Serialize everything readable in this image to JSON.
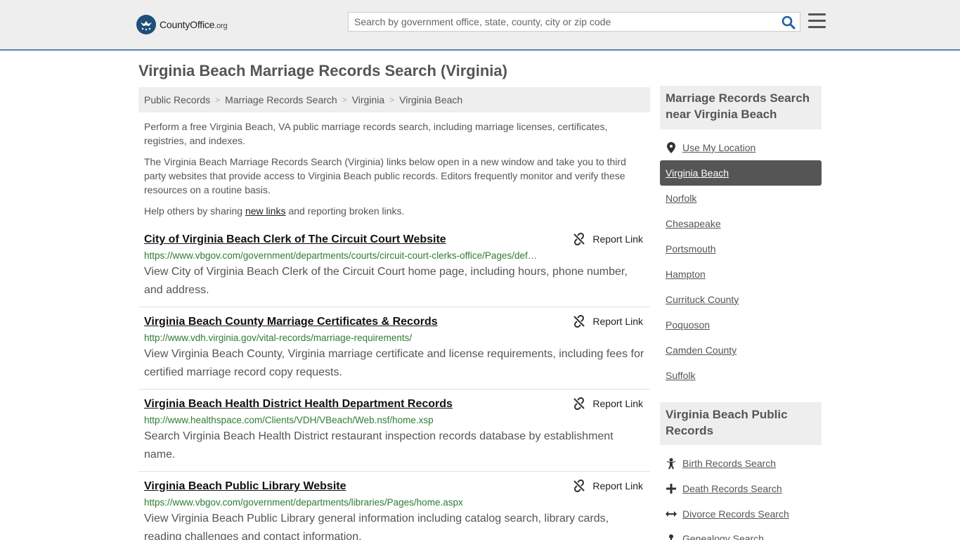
{
  "header": {
    "logo_name": "CountyOffice",
    "logo_tld": ".org",
    "search_placeholder": "Search by government office, state, county, city or zip code"
  },
  "page": {
    "title": "Virginia Beach Marriage Records Search (Virginia)"
  },
  "breadcrumb": [
    "Public Records",
    "Marriage Records Search",
    "Virginia",
    "Virginia Beach"
  ],
  "intro": {
    "p1": "Perform a free Virginia Beach, VA public marriage records search, including marriage licenses, certificates, registries, and indexes.",
    "p2": "The Virginia Beach Marriage Records Search (Virginia) links below open in a new window and take you to third party websites that provide access to Virginia Beach public records. Editors frequently monitor and verify these resources on a routine basis.",
    "p3_before": "Help others by sharing ",
    "p3_link": "new links",
    "p3_after": " and reporting broken links."
  },
  "report_label": "Report Link",
  "results": [
    {
      "title": "City of Virginia Beach Clerk of The Circuit Court Website",
      "url": "https://www.vbgov.com/government/departments/courts/circuit-court-clerks-office/Pages/def…",
      "desc": "View City of Virginia Beach Clerk of the Circuit Court home page, including hours, phone number, and address."
    },
    {
      "title": "Virginia Beach County Marriage Certificates & Records",
      "url": "http://www.vdh.virginia.gov/vital-records/marriage-requirements/",
      "desc": "View Virginia Beach County, Virginia marriage certificate and license requirements, including fees for certified marriage record copy requests."
    },
    {
      "title": "Virginia Beach Health District Health Department Records",
      "url": "http://www.healthspace.com/Clients/VDH/VBeach/Web.nsf/home.xsp",
      "desc": "Search Virginia Beach Health District restaurant inspection records database by establishment name."
    },
    {
      "title": "Virginia Beach Public Library Website",
      "url": "https://www.vbgov.com/government/departments/libraries/Pages/home.aspx",
      "desc": "View Virginia Beach Public Library general information including catalog search, library cards, reading challenges and contact information."
    }
  ],
  "sidebar": {
    "nearby_heading": "Marriage Records Search near Virginia Beach",
    "use_location": "Use My Location",
    "nearby": [
      "Virginia Beach",
      "Norfolk",
      "Chesapeake",
      "Portsmouth",
      "Hampton",
      "Currituck County",
      "Poquoson",
      "Camden County",
      "Suffolk"
    ],
    "active_index": 0,
    "public_heading": "Virginia Beach Public Records",
    "public_links": [
      {
        "label": "Birth Records Search",
        "icon": "baby-icon"
      },
      {
        "label": "Death Records Search",
        "icon": "cross-icon"
      },
      {
        "label": "Divorce Records Search",
        "icon": "split-arrows-icon"
      },
      {
        "label": "Genealogy Search",
        "icon": "tree-icon"
      }
    ]
  },
  "colors": {
    "header_bg": "#eeeeee",
    "header_border": "#5e81a8",
    "url_green": "#2e7d32",
    "active_bg": "#555555",
    "logo_blue": "#1f4e79"
  }
}
